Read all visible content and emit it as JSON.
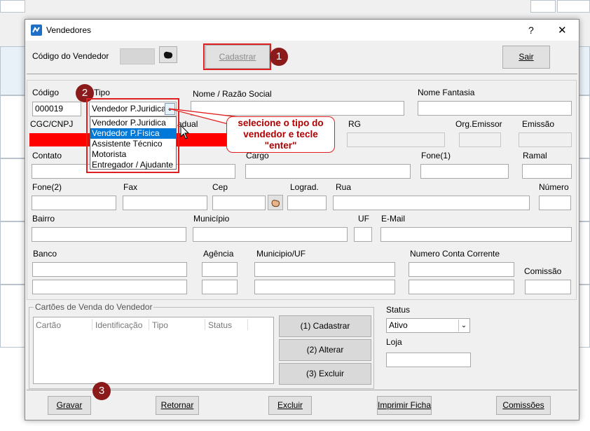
{
  "window": {
    "title": "Vendedores",
    "help": "?",
    "close": "✕"
  },
  "top": {
    "vendor_code_label": "Código do Vendedor",
    "register_label": "Cadastrar",
    "exit_label": "Sair"
  },
  "form": {
    "codigo_label": "Código",
    "codigo_value": "000019",
    "tipo_label": "Tipo",
    "tipo_value": "Vendedor P.Juridica",
    "razao_label": "Nome / Razão Social",
    "fantasia_label": "Nome Fantasia",
    "cgc_label": "CGC/CNPJ",
    "ie_label_partial": "adual",
    "rg_label": "RG",
    "org_label": "Org.Emissor",
    "emissao_label": "Emissão",
    "contato_label": "Contato",
    "cargo_label": "Cargo",
    "fone1_label": "Fone(1)",
    "ramal_label": "Ramal",
    "fone2_label": "Fone(2)",
    "fax_label": "Fax",
    "cep_label": "Cep",
    "lograd_label": "Lograd.",
    "rua_label": "Rua",
    "numero_label": "Número",
    "bairro_label": "Bairro",
    "municipio_label": "Município",
    "uf_label": "UF",
    "email_label": "E-Mail",
    "banco_label": "Banco",
    "agencia_label": "Agência",
    "municipio_uf_label": "Municipio/UF",
    "conta_label": "Numero Conta Corrente",
    "comissao_label": "Comissão"
  },
  "dropdown": {
    "options": [
      "Vendedor P.Juridica",
      "Vendedor P.Física",
      "Assistente Técnico",
      "Motorista",
      "Entregador / Ajudante"
    ],
    "selected_index": 1
  },
  "annotation": {
    "callout": "selecione o tipo do vendedor e tecle \"enter\"",
    "badge1": "1",
    "badge2": "2",
    "badge3": "3"
  },
  "cards": {
    "legend": "Cartões de Venda do Vendedor",
    "columns": [
      "Cartão",
      "Identificação",
      "Tipo",
      "Status"
    ],
    "add_label": "(1) Cadastrar",
    "edit_label": "(2) Alterar",
    "delete_label": "(3) Excluir"
  },
  "status": {
    "label": "Status",
    "value": "Ativo",
    "loja_label": "Loja"
  },
  "footer": {
    "save": "Gravar",
    "back": "Retornar",
    "delete": "Excluir",
    "print": "Imprimir Ficha",
    "commissions": "Comissões"
  },
  "colors": {
    "highlight_red": "#e02020",
    "badge": "#8b1a1a",
    "select_blue": "#0078d7"
  }
}
